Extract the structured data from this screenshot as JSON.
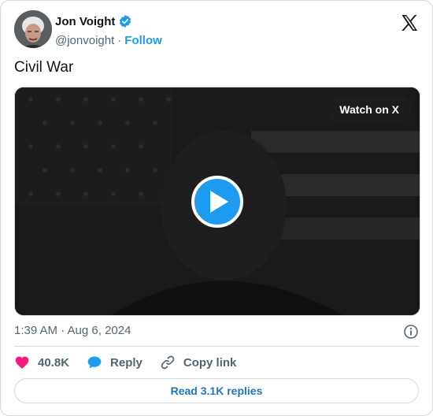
{
  "author": {
    "name": "Jon Voight",
    "handle": "@jonvoight",
    "separator": "·",
    "follow_label": "Follow"
  },
  "tweet": {
    "text": "Civil War",
    "timestamp": "1:39 AM · Aug 6, 2024"
  },
  "media": {
    "watch_label": "Watch on X"
  },
  "actions": {
    "likes": "40.8K",
    "reply_label": "Reply",
    "copy_label": "Copy link"
  },
  "replies_button": "Read 3.1K replies",
  "colors": {
    "accent": "#1d9bf0",
    "like": "#f91880",
    "text": "#0f1419",
    "muted": "#536471"
  },
  "icons": {
    "verified": "verified-badge-icon",
    "brand": "x-logo-icon",
    "play": "play-icon",
    "info": "info-icon",
    "like": "heart-icon",
    "reply": "speech-bubble-icon",
    "copy": "link-icon"
  }
}
